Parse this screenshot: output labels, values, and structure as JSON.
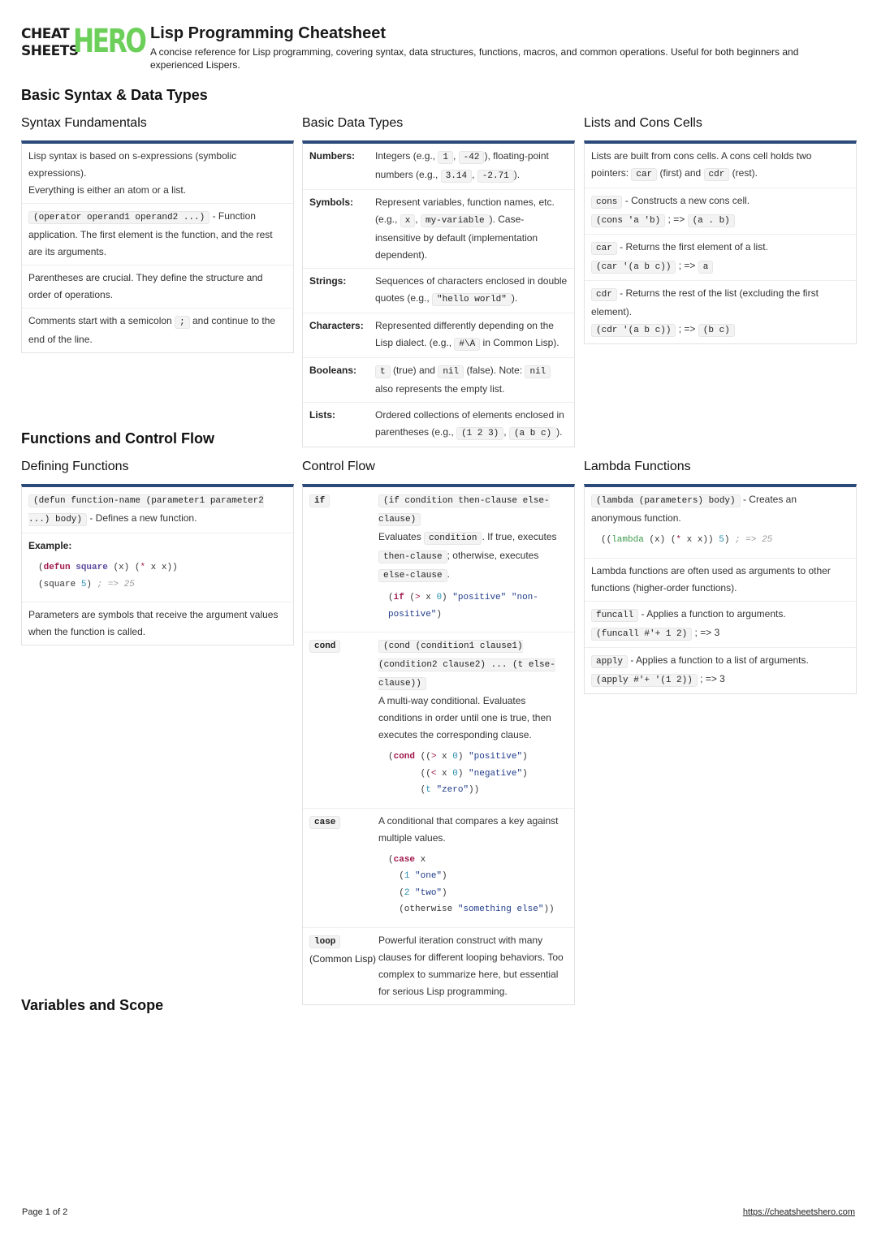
{
  "header": {
    "logo_top": "CHEAT",
    "logo_bottom": "SHEETS",
    "logo_hero": "HERO",
    "title": "Lisp Programming Cheatsheet",
    "subtitle": "A concise reference for Lisp programming, covering syntax, data structures, functions, macros, and common operations. Useful for both beginners and experienced Lispers."
  },
  "sections": {
    "basic": "Basic Syntax & Data Types",
    "functions": "Functions and Control Flow",
    "variables": "Variables and Scope"
  },
  "syntax": {
    "title": "Syntax Fundamentals",
    "r1a": "Lisp syntax is based on s-expressions (symbolic expressions).",
    "r1b": "Everything is either an atom or a list.",
    "r2code": "(operator operand1 operand2 ...)",
    "r2text": " - Function application. The first element is the function, and the rest are its arguments.",
    "r3": "Parentheses are crucial. They define the structure and order of operations.",
    "r4a": "Comments start with a semicolon ",
    "r4code": ";",
    "r4b": " and continue to the end of the line."
  },
  "datatypes": {
    "title": "Basic Data Types",
    "numbers": {
      "k": "Numbers:",
      "t1": "Integers (e.g., ",
      "c1": "1",
      "s1": ", ",
      "c2": "-42",
      "t2": "), floating-point numbers (e.g., ",
      "c3": "3.14",
      "s2": ", ",
      "c4": "-2.71",
      "t3": ")."
    },
    "symbols": {
      "k": "Symbols:",
      "t1": "Represent variables, function names, etc. (e.g., ",
      "c1": "x",
      "s1": ", ",
      "c2": "my-variable",
      "t2": "). Case-insensitive by default (implementation dependent)."
    },
    "strings": {
      "k": "Strings:",
      "t1": "Sequences of characters enclosed in double quotes (e.g., ",
      "c1": "\"hello world\"",
      "t2": ")."
    },
    "characters": {
      "k": "Characters:",
      "t1": "Represented differently depending on the Lisp dialect. (e.g., ",
      "c1": "#\\A",
      "t2": " in Common Lisp)."
    },
    "booleans": {
      "k": "Booleans:",
      "c1": "t",
      "t1": " (true) and ",
      "c2": "nil",
      "t2": " (false). Note: ",
      "c3": "nil",
      "t3": " also represents the empty list."
    },
    "lists": {
      "k": "Lists:",
      "t1": "Ordered collections of elements enclosed in parentheses (e.g., ",
      "c1": "(1 2 3)",
      "s1": ", ",
      "c2": "(a b c)",
      "t2": ")."
    }
  },
  "cons": {
    "title": "Lists and Cons Cells",
    "r1a": "Lists are built from cons cells. A cons cell holds two pointers: ",
    "r1c1": "car",
    "r1b": " (first) and ",
    "r1c2": "cdr",
    "r1d": " (rest).",
    "cons": {
      "name": "cons",
      "desc": " - Constructs a new cons cell.",
      "ex": "(cons 'a 'b)",
      "arrow": " ; => ",
      "res": "(a . b)"
    },
    "car": {
      "name": "car",
      "desc": " - Returns the first element of a list.",
      "ex": "(car '(a b c))",
      "arrow": " ; => ",
      "res": "a"
    },
    "cdr": {
      "name": "cdr",
      "desc": " - Returns the rest of the list (excluding the first element).",
      "ex": "(cdr '(a b c))",
      "arrow": " ; => ",
      "res": "(b c)"
    }
  },
  "defining": {
    "title": "Defining Functions",
    "code": "(defun function-name (parameter1 parameter2 ...) body)",
    "desc": " - Defines a new function.",
    "example_label": "Example:",
    "params": "Parameters are symbols that receive the argument values when the function is called."
  },
  "control": {
    "title": "Control Flow",
    "if": {
      "k": "if",
      "syntax": "(if condition then-clause else-clause)",
      "t1": "Evaluates ",
      "c1": "condition",
      "t2": ". If true, executes ",
      "c2": "then-clause",
      "t3": "; otherwise, executes ",
      "c3": "else-clause",
      "t4": "."
    },
    "cond": {
      "k": "cond",
      "syntax": "(cond (condition1 clause1) (condition2 clause2) ... (t else-clause))",
      "desc": "A multi-way conditional. Evaluates conditions in order until one is true, then executes the corresponding clause."
    },
    "case": {
      "k": "case",
      "desc": "A conditional that compares a key against multiple values."
    },
    "loop": {
      "k": "loop",
      "k2": "(Common Lisp)",
      "desc": "Powerful iteration construct with many clauses for different looping behaviors. Too complex to summarize here, but essential for serious Lisp programming."
    }
  },
  "lambda": {
    "title": "Lambda Functions",
    "code": "(lambda (parameters) body)",
    "desc": " - Creates an anonymous function.",
    "r2": "Lambda functions are often used as arguments to other functions (higher-order functions).",
    "funcall": {
      "name": "funcall",
      "desc": " - Applies a function to arguments.",
      "ex": "(funcall #'+ 1 2)",
      "res": " ; => 3"
    },
    "apply": {
      "name": "apply",
      "desc": " - Applies a function to a list of arguments.",
      "ex": "(apply #'+ '(1 2))",
      "res": " ; => 3"
    }
  },
  "footer": {
    "page": "Page 1 of 2",
    "url": "https://cheatsheetshero.com"
  }
}
